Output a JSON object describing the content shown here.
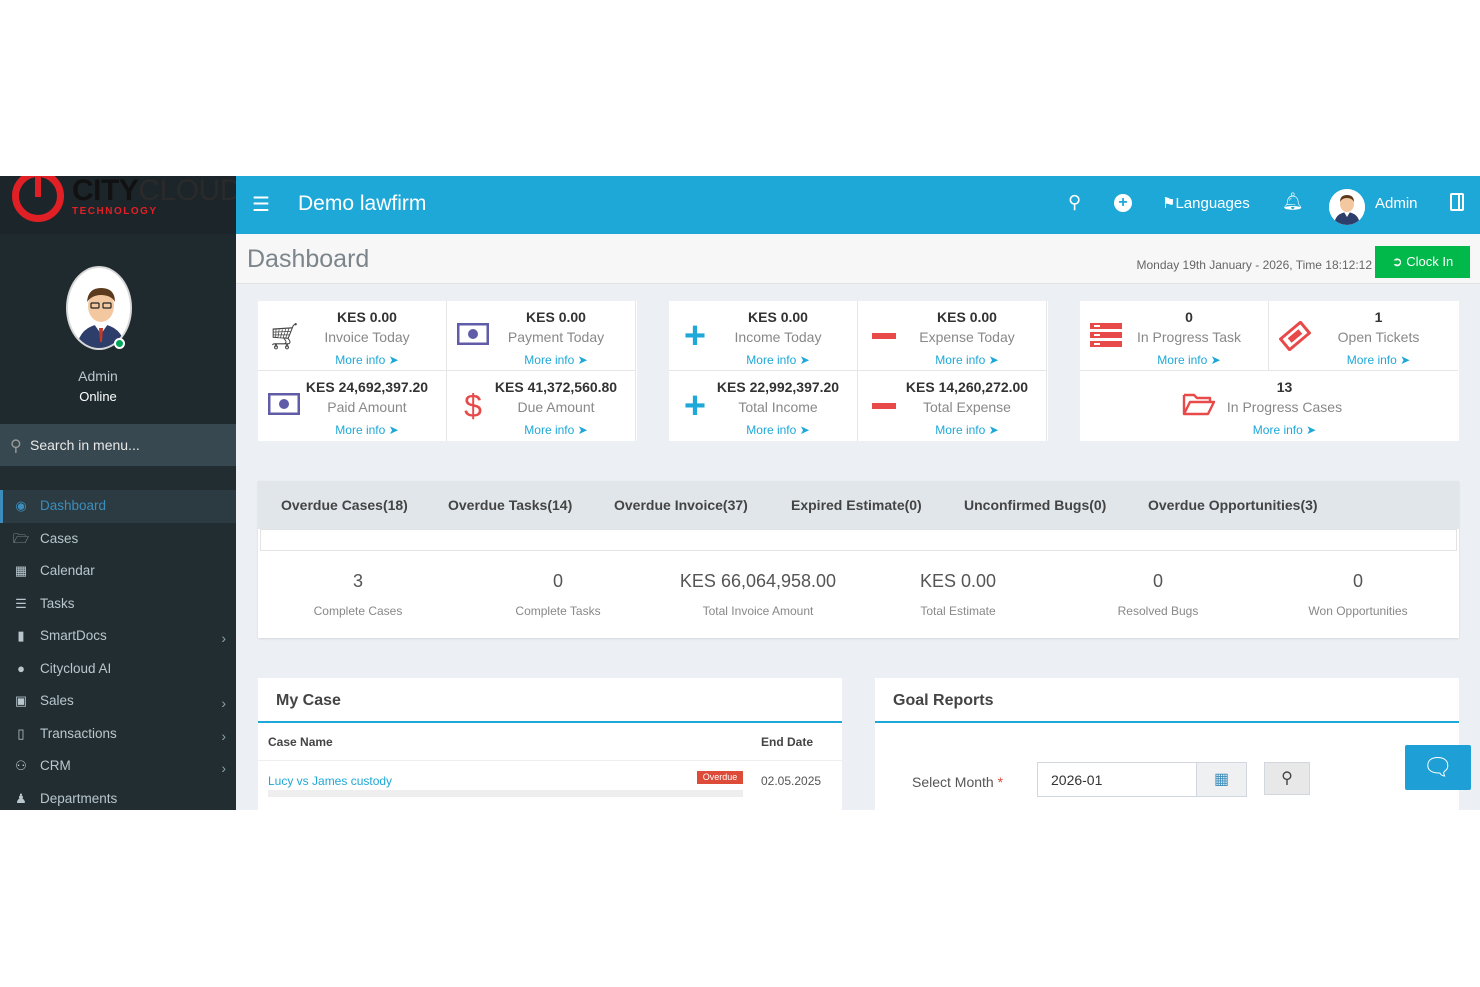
{
  "brand": {
    "name_bold": "CITY",
    "name_light": "CLOUD",
    "tagline": "TECHNOLOGY"
  },
  "sidebar": {
    "user_name": "Admin",
    "user_status": "Online",
    "search_placeholder": "Search in menu...",
    "items": [
      {
        "label": "Dashboard",
        "icon": "dashboard-icon",
        "active": true
      },
      {
        "label": "Cases",
        "icon": "folder-open-icon"
      },
      {
        "label": "Calendar",
        "icon": "calendar-icon"
      },
      {
        "label": "Tasks",
        "icon": "tasks-icon"
      },
      {
        "label": "SmartDocs",
        "icon": "file-icon",
        "submenu": true
      },
      {
        "label": "Citycloud AI",
        "icon": "comments-icon"
      },
      {
        "label": "Sales",
        "icon": "cart-icon",
        "submenu": true
      },
      {
        "label": "Transactions",
        "icon": "book-icon",
        "submenu": true
      },
      {
        "label": "CRM",
        "icon": "users-icon",
        "submenu": true
      },
      {
        "label": "Departments",
        "icon": "user-secret-icon"
      }
    ]
  },
  "header": {
    "title": "Demo lawfirm",
    "languages_label": "Languages",
    "user_label": "Admin"
  },
  "content_header": {
    "title": "Dashboard",
    "datetime": "Monday 19th January - 2026,  Time  18:12:12",
    "clock_in_label": "Clock In"
  },
  "stats": {
    "invoice_today": {
      "value": "KES 0.00",
      "label": "Invoice Today"
    },
    "payment_today": {
      "value": "KES 0.00",
      "label": "Payment Today"
    },
    "paid_amount": {
      "value": "KES 24,692,397.20",
      "label": "Paid Amount"
    },
    "due_amount": {
      "value": "KES 41,372,560.80",
      "label": "Due Amount"
    },
    "income_today": {
      "value": "KES 0.00",
      "label": "Income Today"
    },
    "expense_today": {
      "value": "KES 0.00",
      "label": "Expense Today"
    },
    "total_income": {
      "value": "KES 22,992,397.20",
      "label": "Total Income"
    },
    "total_expense": {
      "value": "KES 14,260,272.00",
      "label": "Total Expense"
    },
    "in_progress_task": {
      "value": "0",
      "label": "In Progress Task"
    },
    "open_tickets": {
      "value": "1",
      "label": "Open Tickets"
    },
    "in_progress_cases": {
      "value": "13",
      "label": "In Progress Cases"
    },
    "more_info": "More info"
  },
  "tabs": [
    "Overdue Cases(18)",
    "Overdue Tasks(14)",
    "Overdue Invoice(37)",
    "Expired Estimate(0)",
    "Unconfirmed Bugs(0)",
    "Overdue Opportunities(3)"
  ],
  "metrics": [
    {
      "value": "3",
      "label": "Complete Cases"
    },
    {
      "value": "0",
      "label": "Complete Tasks"
    },
    {
      "value": "KES 66,064,958.00",
      "label": "Total Invoice Amount"
    },
    {
      "value": "KES 0.00",
      "label": "Total Estimate"
    },
    {
      "value": "0",
      "label": "Resolved Bugs"
    },
    {
      "value": "0",
      "label": "Won Opportunities"
    }
  ],
  "my_case": {
    "title": "My Case",
    "col_name": "Case Name",
    "col_end": "End Date",
    "rows": [
      {
        "name": "Lucy vs James custody",
        "badge": "Overdue",
        "end_date": "02.05.2025"
      }
    ]
  },
  "goal_reports": {
    "title": "Goal Reports",
    "select_label": "Select Month",
    "required_mark": "*",
    "month_value": "2026-01"
  },
  "colors": {
    "header": "#1ea8d8",
    "sidebar": "#222d32",
    "accent_green": "#00b94a",
    "danger": "#dd4b39",
    "income_plus": "#1ea8d8",
    "expense_minus": "#e84a4a",
    "purple": "#605ca8"
  }
}
